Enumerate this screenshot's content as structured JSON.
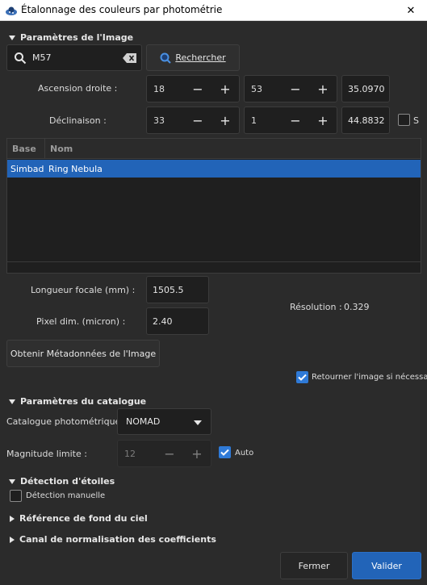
{
  "window": {
    "title": "Étalonnage des couleurs par photométrie",
    "close_glyph": "✕"
  },
  "image_params": {
    "section_title": "Paramètres de l'Image",
    "search": {
      "value": "M57",
      "button_label": "Rechercher"
    },
    "ra": {
      "label": "Ascension droite :",
      "hours": "18",
      "minutes": "53",
      "seconds": "35.0970"
    },
    "dec": {
      "label": "Déclinaison :",
      "degrees": "33",
      "minutes": "1",
      "seconds": "44.8832",
      "south_label": "S",
      "south_checked": false
    },
    "table": {
      "columns": [
        "Base",
        "Nom"
      ],
      "rows": [
        {
          "base": "Simbad",
          "name": "Ring Nebula",
          "selected": true
        }
      ]
    },
    "focal": {
      "label": "Longueur focale (mm) :",
      "value": "1505.5"
    },
    "pixel": {
      "label": "Pixel dim. (micron) :",
      "value": "2.40"
    },
    "resolution": {
      "label": "Résolution :",
      "value": "0.329"
    },
    "metadata_button": "Obtenir Métadonnées de l'Image",
    "flip": {
      "label": "Retourner l'image si nécessaire",
      "checked": true
    }
  },
  "catalog_params": {
    "section_title": "Paramètres du catalogue",
    "catalog": {
      "label": "Catalogue photométrique :",
      "value": "NOMAD"
    },
    "magnitude": {
      "label": "Magnitude limite :",
      "value": "12",
      "auto_label": "Auto",
      "auto_checked": true
    }
  },
  "star_detection": {
    "section_title": "Détection d'étoiles",
    "manual_label": "Détection manuelle",
    "manual_checked": false
  },
  "sky_background": {
    "section_title": "Référence de fond du ciel"
  },
  "normalization": {
    "section_title": "Canal de normalisation des coefficients"
  },
  "buttons": {
    "close": "Fermer",
    "validate": "Valider"
  },
  "colors": {
    "accent": "#2264b8",
    "background": "#2b2b2b",
    "field": "#1f1f1f"
  }
}
